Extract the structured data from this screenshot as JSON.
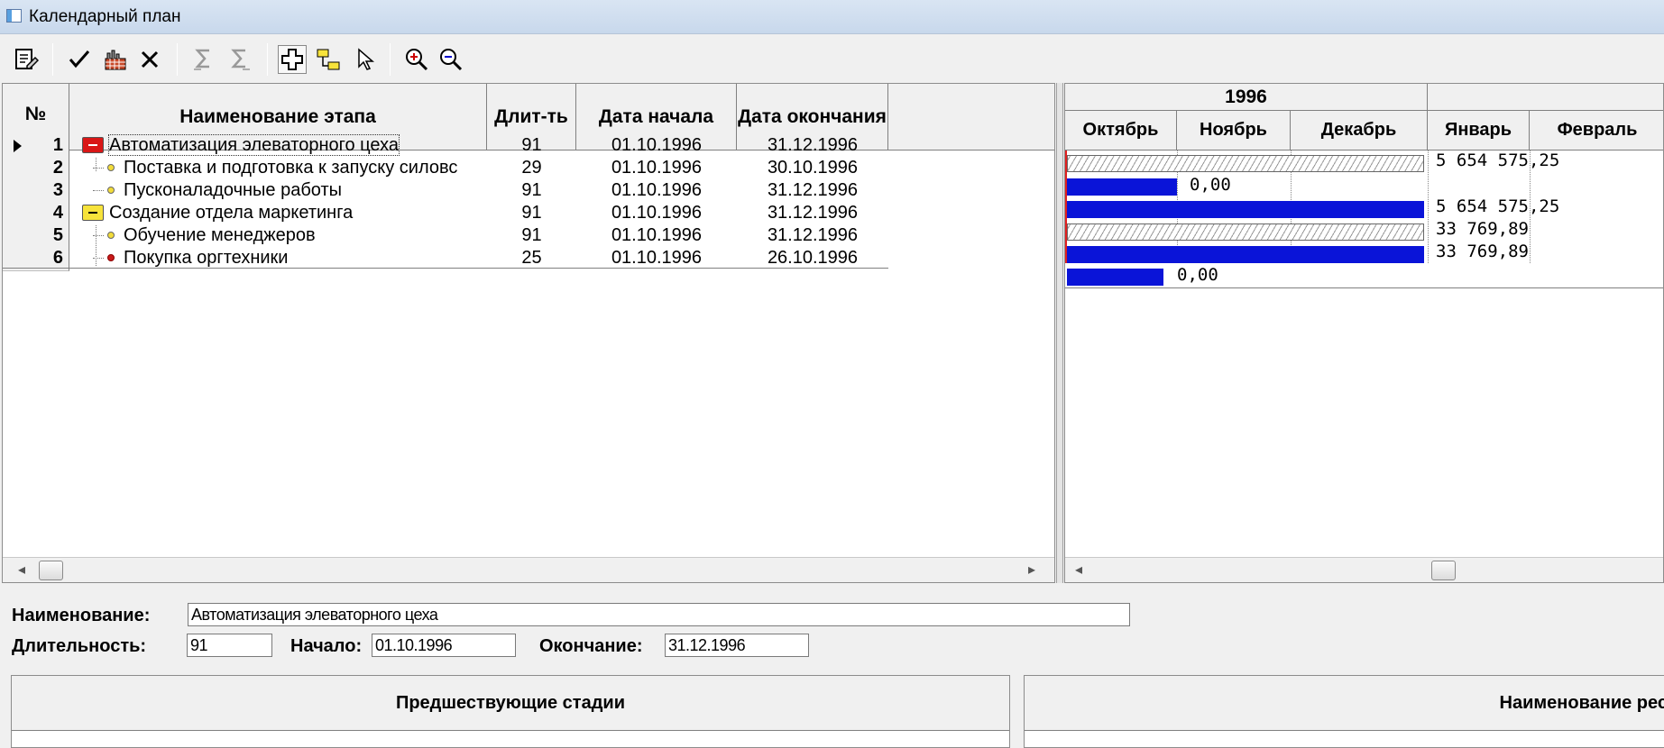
{
  "window": {
    "title": "Календарный план"
  },
  "toolbar": {
    "buttons": [
      {
        "icon": "note-edit-icon"
      },
      {
        "icon": "checkmark-icon"
      },
      {
        "icon": "factory-resources-icon"
      },
      {
        "icon": "delete-x-icon"
      },
      {
        "icon": "sum-left-icon"
      },
      {
        "icon": "sum-right-icon"
      },
      {
        "icon": "add-cross-icon"
      },
      {
        "icon": "hierarchy-icon"
      },
      {
        "icon": "pointer-icon"
      },
      {
        "icon": "zoom-in-icon"
      },
      {
        "icon": "zoom-out-icon"
      }
    ]
  },
  "grid": {
    "columns": {
      "num": "№",
      "name": "Наименование этапа",
      "duration": "Длит-ть",
      "start": "Дата начала",
      "end": "Дата окончания"
    },
    "rows": [
      {
        "num": "1",
        "name": "Автоматизация элеваторного цеха",
        "duration": "91",
        "start": "01.10.1996",
        "end": "31.12.1996",
        "icon": "red-folder-icon"
      },
      {
        "num": "2",
        "name": "Поставка и подготовка к запуску силовс",
        "duration": "29",
        "start": "01.10.1996",
        "end": "30.10.1996",
        "icon": "yellow-dot-icon"
      },
      {
        "num": "3",
        "name": "Пусконаладочные работы",
        "duration": "91",
        "start": "01.10.1996",
        "end": "31.12.1996",
        "icon": "yellow-dot-icon"
      },
      {
        "num": "4",
        "name": "Создание отдела маркетинга",
        "duration": "91",
        "start": "01.10.1996",
        "end": "31.12.1996",
        "icon": "yellow-folder-icon"
      },
      {
        "num": "5",
        "name": "Обучение менеджеров",
        "duration": "91",
        "start": "01.10.1996",
        "end": "31.12.1996",
        "icon": "yellow-dot-icon"
      },
      {
        "num": "6",
        "name": "Покупка оргтехники",
        "duration": "25",
        "start": "01.10.1996",
        "end": "26.10.1996",
        "icon": "red-dot-icon"
      }
    ]
  },
  "gantt": {
    "year": "1996",
    "months": [
      "Октябрь",
      "Ноябрь",
      "Декабрь",
      "Январь",
      "Февраль"
    ],
    "bars": [
      {
        "row": 1,
        "style": "hatched",
        "label": "5 654 575,25"
      },
      {
        "row": 2,
        "style": "solid",
        "label": "0,00"
      },
      {
        "row": 3,
        "style": "solid",
        "label": "5 654 575,25"
      },
      {
        "row": 4,
        "style": "hatched",
        "label": "33 769,89"
      },
      {
        "row": 5,
        "style": "solid",
        "label": "33 769,89"
      },
      {
        "row": 6,
        "style": "solid",
        "label": "0,00"
      }
    ]
  },
  "form": {
    "name_label": "Наименование:",
    "name_value": "Автоматизация элеваторного цеха",
    "duration_label": "Длительность:",
    "duration_value": "91",
    "start_label": "Начало:",
    "start_value": "01.10.1996",
    "end_label": "Окончание:",
    "end_value": "31.12.1996",
    "predecessors_header": "Предшествующие стадии",
    "resources_header": "Наименование рес"
  },
  "colors": {
    "bar_solid": "#0a14d8",
    "today_line": "#e02020",
    "summary_folder": "#d91616",
    "sub_folder": "#f7e33b"
  }
}
